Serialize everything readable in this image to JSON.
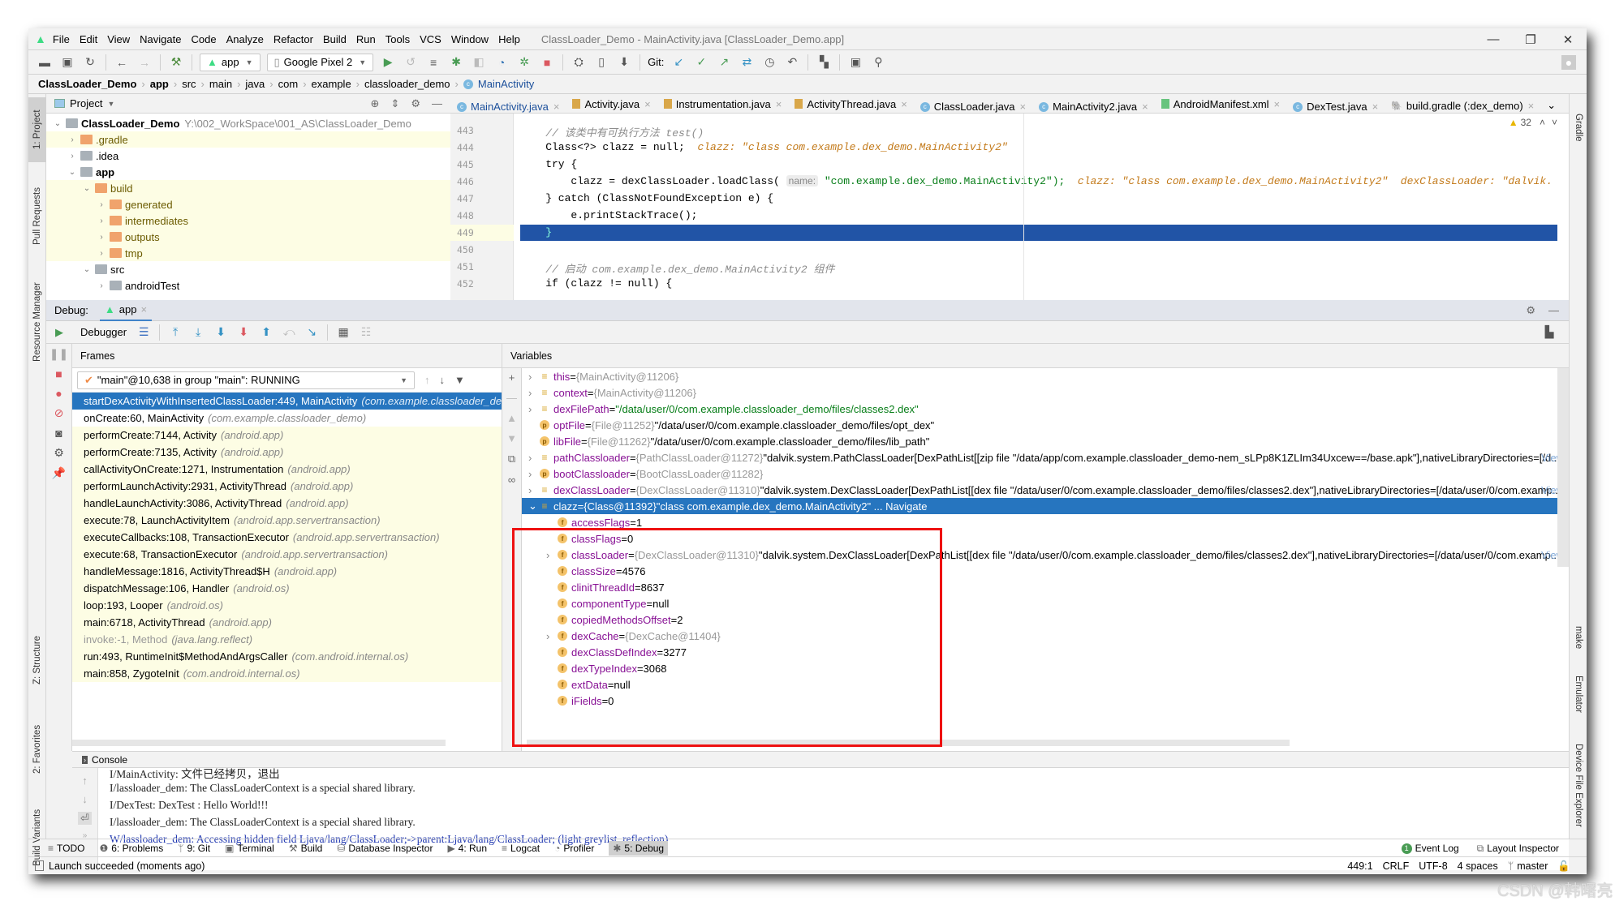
{
  "app": {
    "window_title": "ClassLoader_Demo - MainActivity.java [ClassLoader_Demo.app]",
    "menu": [
      "File",
      "Edit",
      "View",
      "Navigate",
      "Code",
      "Analyze",
      "Refactor",
      "Build",
      "Run",
      "Tools",
      "VCS",
      "Window",
      "Help"
    ],
    "window_controls": {
      "minimize": "—",
      "restore": "❐",
      "close": "✕"
    }
  },
  "toolbar": {
    "run_config": "app",
    "device": "Google Pixel 2",
    "git_label": "Git:"
  },
  "breadcrumb": [
    "ClassLoader_Demo",
    "app",
    "src",
    "main",
    "java",
    "com",
    "example",
    "classloader_demo",
    "MainActivity"
  ],
  "left_strip": [
    "1: Project",
    "Pull Requests",
    "Resource Manager",
    "Z: Structure",
    "2: Favorites",
    "Build Variants"
  ],
  "right_strip": [
    "Gradle",
    "make",
    "Emulator",
    "Device File Explorer"
  ],
  "project": {
    "header": "Project",
    "tree": [
      {
        "label": "ClassLoader_Demo",
        "path": "Y:\\002_WorkSpace\\001_AS\\ClassLoader_Demo",
        "level": 0,
        "expanded": true,
        "bold": true,
        "folder": "gray"
      },
      {
        "label": ".gradle",
        "level": 1,
        "expanded": false,
        "folder": "orange",
        "highlight": true
      },
      {
        "label": ".idea",
        "level": 1,
        "expanded": false,
        "folder": "gray"
      },
      {
        "label": "app",
        "level": 1,
        "expanded": true,
        "bold": true,
        "folder": "gray"
      },
      {
        "label": "build",
        "level": 2,
        "expanded": true,
        "folder": "orange",
        "highlight": true
      },
      {
        "label": "generated",
        "level": 3,
        "expanded": false,
        "folder": "orange",
        "highlight": true
      },
      {
        "label": "intermediates",
        "level": 3,
        "expanded": false,
        "folder": "orange",
        "highlight": true
      },
      {
        "label": "outputs",
        "level": 3,
        "expanded": false,
        "folder": "orange",
        "highlight": true
      },
      {
        "label": "tmp",
        "level": 3,
        "expanded": false,
        "folder": "orange",
        "highlight": true
      },
      {
        "label": "src",
        "level": 2,
        "expanded": true,
        "folder": "gray"
      },
      {
        "label": "androidTest",
        "level": 3,
        "expanded": false,
        "folder": "gray"
      }
    ]
  },
  "editor": {
    "tabs": [
      {
        "label": "MainActivity.java",
        "icon": "class",
        "active": true
      },
      {
        "label": "Activity.java",
        "icon": "java"
      },
      {
        "label": "Instrumentation.java",
        "icon": "java"
      },
      {
        "label": "ActivityThread.java",
        "icon": "java"
      },
      {
        "label": "ClassLoader.java",
        "icon": "class"
      },
      {
        "label": "MainActivity2.java",
        "icon": "class"
      },
      {
        "label": "AndroidManifest.xml",
        "icon": "manifest"
      },
      {
        "label": "DexTest.java",
        "icon": "class"
      },
      {
        "label": "build.gradle (:dex_demo)",
        "icon": "gradle"
      }
    ],
    "warnings_count": "32",
    "lines": [
      {
        "n": "443",
        "text": "    // 该类中有可执行方法 test()"
      },
      {
        "n": "444",
        "text": "    Class<?> clazz = null;",
        "hint": "clazz: \"class com.example.dex_demo.MainActivity2\""
      },
      {
        "n": "445",
        "text": "    try {"
      },
      {
        "n": "446",
        "text": "        clazz = dexClassLoader.loadClass(",
        "inlay": "name:",
        "arg": "\"com.example.dex_demo.MainActivity2\");",
        "hint": "clazz: \"class com.example.dex_demo.MainActivity2\"  dexClassLoader: \"dalvik."
      },
      {
        "n": "447",
        "text": "    } catch (ClassNotFoundException e) {"
      },
      {
        "n": "448",
        "text": "        e.printStackTrace();"
      },
      {
        "n": "449",
        "text": "    }",
        "current": true
      },
      {
        "n": "450",
        "text": ""
      },
      {
        "n": "451",
        "text": "    // 启动 com.example.dex_demo.MainActivity2 组件"
      },
      {
        "n": "452",
        "text": "    if (clazz != null) {"
      }
    ]
  },
  "debug": {
    "label": "Debug:",
    "session_tab": "app",
    "debugger_tab": "Debugger",
    "frames_header": "Frames",
    "variables_header": "Variables",
    "thread": "\"main\"@10,638 in group \"main\": RUNNING",
    "frames": [
      {
        "method": "startDexActivityWithInsertedClassLoader:449, MainActivity",
        "pkg": "(com.example.classloader_demo)",
        "selected": true
      },
      {
        "method": "onCreate:60, MainActivity",
        "pkg": "(com.example.classloader_demo)"
      },
      {
        "method": "performCreate:7144, Activity",
        "pkg": "(android.app)",
        "lib": true
      },
      {
        "method": "performCreate:7135, Activity",
        "pkg": "(android.app)",
        "lib": true
      },
      {
        "method": "callActivityOnCreate:1271, Instrumentation",
        "pkg": "(android.app)",
        "lib": true
      },
      {
        "method": "performLaunchActivity:2931, ActivityThread",
        "pkg": "(android.app)",
        "lib": true
      },
      {
        "method": "handleLaunchActivity:3086, ActivityThread",
        "pkg": "(android.app)",
        "lib": true
      },
      {
        "method": "execute:78, LaunchActivityItem",
        "pkg": "(android.app.servertransaction)",
        "lib": true
      },
      {
        "method": "executeCallbacks:108, TransactionExecutor",
        "pkg": "(android.app.servertransaction)",
        "lib": true
      },
      {
        "method": "execute:68, TransactionExecutor",
        "pkg": "(android.app.servertransaction)",
        "lib": true
      },
      {
        "method": "handleMessage:1816, ActivityThread$H",
        "pkg": "(android.app)",
        "lib": true
      },
      {
        "method": "dispatchMessage:106, Handler",
        "pkg": "(android.os)",
        "lib": true
      },
      {
        "method": "loop:193, Looper",
        "pkg": "(android.os)",
        "lib": true
      },
      {
        "method": "main:6718, ActivityThread",
        "pkg": "(android.app)",
        "lib": true
      },
      {
        "method": "invoke:-1, Method",
        "pkg": "(java.lang.reflect)",
        "lib": true,
        "dim": true
      },
      {
        "method": "run:493, RuntimeInit$MethodAndArgsCaller",
        "pkg": "(com.android.internal.os)",
        "lib": true
      },
      {
        "method": "main:858, ZygoteInit",
        "pkg": "(com.android.internal.os)",
        "lib": true
      }
    ],
    "variables": [
      {
        "indent": 0,
        "expand": true,
        "icon": "l",
        "name": "this",
        "ref": "{MainActivity@11206}",
        "val": ""
      },
      {
        "indent": 0,
        "expand": true,
        "icon": "l",
        "name": "context",
        "ref": "{MainActivity@11206}",
        "val": ""
      },
      {
        "indent": 0,
        "expand": true,
        "icon": "l",
        "name": "dexFilePath",
        "ref": "",
        "str": "\"/data/user/0/com.example.classloader_demo/files/classes2.dex\""
      },
      {
        "indent": 0,
        "expand": false,
        "icon": "p",
        "name": "optFile",
        "ref": "{File@11252}",
        "val": "\"/data/user/0/com.example.classloader_demo/files/opt_dex\""
      },
      {
        "indent": 0,
        "expand": false,
        "icon": "p",
        "name": "libFile",
        "ref": "{File@11262}",
        "val": "\"/data/user/0/com.example.classloader_demo/files/lib_path\""
      },
      {
        "indent": 0,
        "expand": true,
        "icon": "l",
        "name": "pathClassloader",
        "ref": "{PathClassLoader@11272}",
        "val": "\"dalvik.system.PathClassLoader[DexPathList[[zip file \"/data/app/com.example.classloader_demo-nem_sLPp8K1ZLIm34Uxcew==/base.apk\"],nativeLibraryDirectories=[/d...",
        "view": "View"
      },
      {
        "indent": 0,
        "expand": true,
        "icon": "p",
        "name": "bootClassloader",
        "ref": "{BootClassLoader@11282}",
        "val": ""
      },
      {
        "indent": 0,
        "expand": true,
        "icon": "l",
        "name": "dexClassLoader",
        "ref": "{DexClassLoader@11310}",
        "val": "\"dalvik.system.DexClassLoader[DexPathList[[dex file \"/data/user/0/com.example.classloader_demo/files/classes2.dex\"],nativeLibraryDirectories=[/data/user/0/com.examp...",
        "view": "View"
      },
      {
        "indent": 0,
        "expand": "open",
        "icon": "l",
        "name": "clazz",
        "ref": "{Class@11392}",
        "val": "\"class com.example.dex_demo.MainActivity2\" ... Navigate",
        "selected": true
      },
      {
        "indent": 1,
        "expand": false,
        "icon": "f",
        "name": "accessFlags",
        "ref": "",
        "val": "1"
      },
      {
        "indent": 1,
        "expand": false,
        "icon": "f",
        "name": "classFlags",
        "ref": "",
        "val": "0"
      },
      {
        "indent": 1,
        "expand": true,
        "icon": "f",
        "name": "classLoader",
        "ref": "{DexClassLoader@11310}",
        "val": "\"dalvik.system.DexClassLoader[DexPathList[[dex file \"/data/user/0/com.example.classloader_demo/files/classes2.dex\"],nativeLibraryDirectories=[/data/user/0/com.examp...",
        "view": "View"
      },
      {
        "indent": 1,
        "expand": false,
        "icon": "f",
        "name": "classSize",
        "ref": "",
        "val": "4576"
      },
      {
        "indent": 1,
        "expand": false,
        "icon": "f",
        "name": "clinitThreadId",
        "ref": "",
        "val": "8637"
      },
      {
        "indent": 1,
        "expand": false,
        "icon": "f",
        "name": "componentType",
        "ref": "",
        "val": "null"
      },
      {
        "indent": 1,
        "expand": false,
        "icon": "f",
        "name": "copiedMethodsOffset",
        "ref": "",
        "val": "2"
      },
      {
        "indent": 1,
        "expand": true,
        "icon": "f",
        "name": "dexCache",
        "ref": "{DexCache@11404}",
        "val": ""
      },
      {
        "indent": 1,
        "expand": false,
        "icon": "f",
        "name": "dexClassDefIndex",
        "ref": "",
        "val": "3277"
      },
      {
        "indent": 1,
        "expand": false,
        "icon": "f",
        "name": "dexTypeIndex",
        "ref": "",
        "val": "3068"
      },
      {
        "indent": 1,
        "expand": false,
        "icon": "f",
        "name": "extData",
        "ref": "",
        "val": "null"
      },
      {
        "indent": 1,
        "expand": false,
        "icon": "f",
        "name": "iFields",
        "ref": "",
        "val": "0"
      }
    ]
  },
  "console": {
    "header": "Console",
    "lines": [
      {
        "text": "I/MainActivity: 文件已经拷贝，退出",
        "level": "info"
      },
      {
        "text": "I/lassloader_dem: The ClassLoaderContext is a special shared library.",
        "level": "info"
      },
      {
        "text": "I/DexTest: DexTest : Hello World!!!",
        "level": "info"
      },
      {
        "text": "I/lassloader_dem: The ClassLoaderContext is a special shared library.",
        "level": "info"
      },
      {
        "text": "W/lassloader_dem: Accessing hidden field Ljava/lang/ClassLoader;->parent:Ljava/lang/ClassLoader; (light greylist, reflection)",
        "level": "warn"
      }
    ]
  },
  "bottom_tools": [
    "TODO",
    "6: Problems",
    "9: Git",
    "Terminal",
    "Build",
    "Database Inspector",
    "4: Run",
    "Logcat",
    "Profiler",
    "5: Debug"
  ],
  "bottom_right": {
    "event_log": "Event Log",
    "event_count": "1",
    "layout_inspector": "Layout Inspector"
  },
  "status": {
    "message": "Launch succeeded (moments ago)",
    "position": "449:1",
    "line_sep": "CRLF",
    "encoding": "UTF-8",
    "indent": "4 spaces",
    "branch": "master"
  },
  "watermark": "CSDN @韩曙亮",
  "colors": {
    "selection": "#2675bf",
    "current_line": "#2154a6",
    "library_frame": "#fdfde4",
    "highlight_box": "#e11111"
  }
}
